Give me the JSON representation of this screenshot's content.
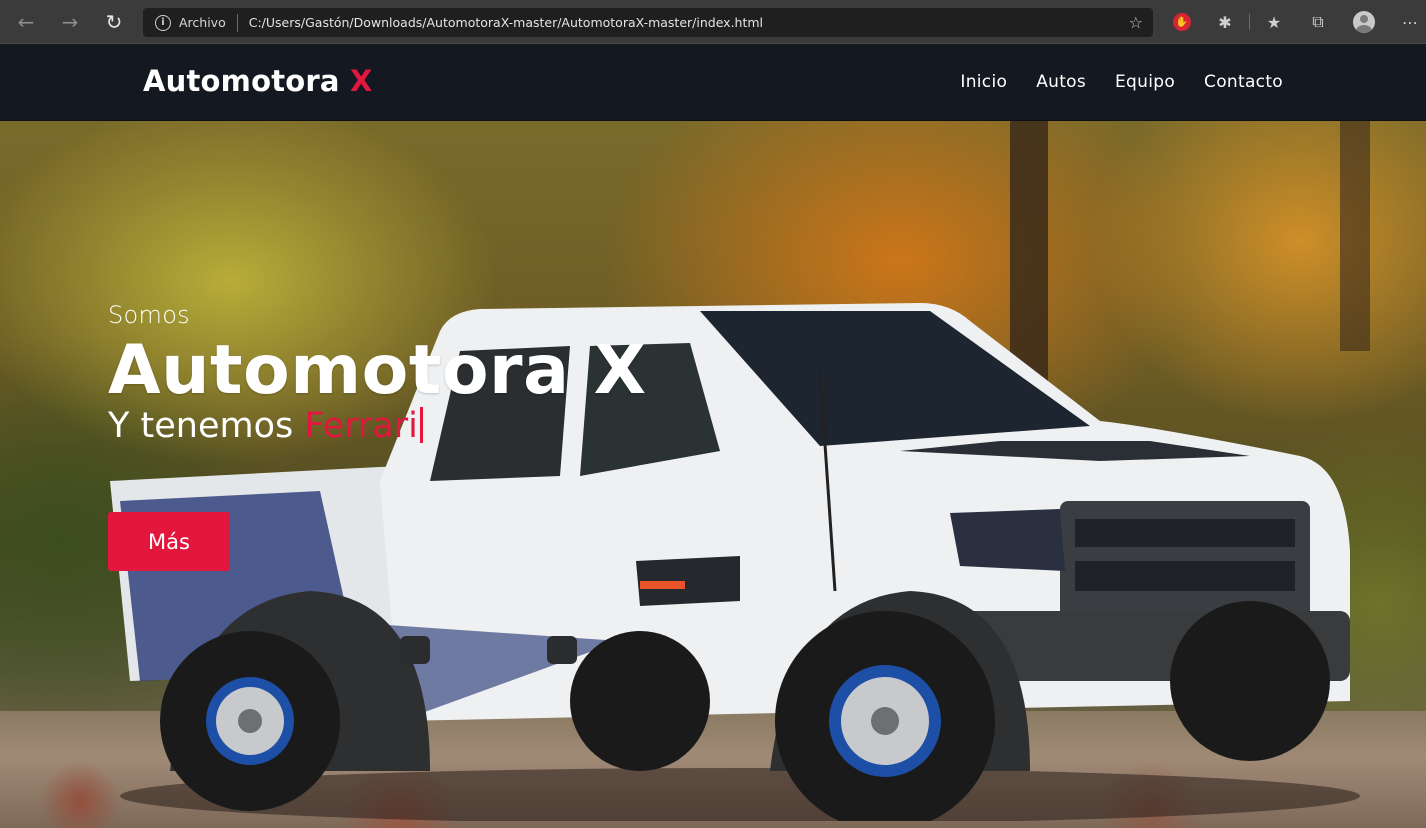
{
  "browser": {
    "address_prefix": "Archivo",
    "url": "C:/Users/Gastón/Downloads/AutomotoraX-master/AutomotoraX-master/index.html",
    "icons": [
      "back-icon",
      "forward-icon",
      "refresh-icon",
      "info-icon",
      "add-favorite-icon",
      "extension-red-icon",
      "extensions-icon",
      "favorites-icon",
      "collections-icon",
      "profile-icon",
      "more-icon"
    ]
  },
  "site": {
    "logo_text": "Automotora ",
    "logo_accent": "X",
    "accent_color": "#e3173e",
    "header_bg": "#141820",
    "nav": [
      {
        "label": "Inicio"
      },
      {
        "label": "Autos"
      },
      {
        "label": "Equipo"
      },
      {
        "label": "Contacto"
      }
    ]
  },
  "hero": {
    "pre": "Somos",
    "title": "Automotora X",
    "sub_prefix": "Y tenemos ",
    "sub_typed": "Ferrari",
    "button_label": "Más"
  }
}
